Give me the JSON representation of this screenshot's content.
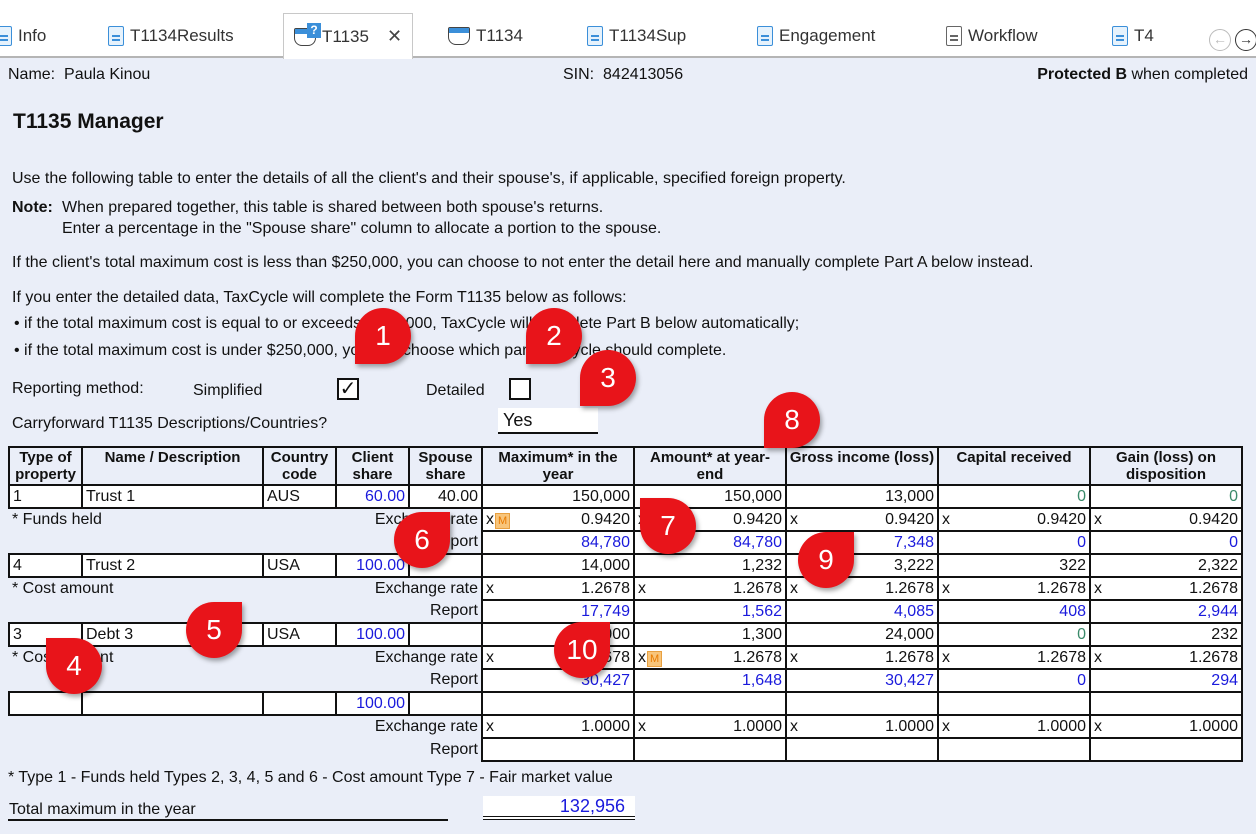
{
  "tabs": [
    {
      "label": "Info",
      "icon": "document-icon"
    },
    {
      "label": "T1134Results",
      "icon": "document-icon"
    },
    {
      "label": "T1135",
      "icon": "form-question-icon",
      "active": true
    },
    {
      "label": "T1134",
      "icon": "form-icon"
    },
    {
      "label": "T1134Sup",
      "icon": "document-icon"
    },
    {
      "label": "Engagement",
      "icon": "document-icon"
    },
    {
      "label": "Workflow",
      "icon": "document-icon"
    },
    {
      "label": "T4",
      "icon": "document-icon"
    }
  ],
  "tab_close": "✕",
  "nav": {
    "back": "←",
    "forward": "→"
  },
  "header": {
    "name_label": "Name:",
    "name": "Paula Kinou",
    "sin_label": "SIN:",
    "sin": "842413056",
    "protected_bold": "Protected B",
    "protected_rest": " when completed"
  },
  "title": "T1135 Manager",
  "intro": "Use the following table to enter the details of all the client's and their spouse's, if applicable, specified foreign property.",
  "note_label": "Note:",
  "note_line1": "When prepared together, this table is shared between both spouse's returns.",
  "note_line2": "Enter a percentage in the \"Spouse share\" column to allocate a portion to the spouse.",
  "para2": "If the client's total maximum cost is less than $250,000, you can choose to not enter the detail here and manually complete Part A below instead.",
  "para3": "If you enter the detailed data, TaxCycle will complete the Form T1135 below as follows:",
  "bullet1": "•  if the total maximum cost is equal to or exceeds $250,000, TaxCycle will complete Part B below automatically;",
  "bullet2": "•  if the total maximum cost is under $250,000, you can choose which part TaxCycle should complete.",
  "reporting": {
    "label": "Reporting method:",
    "simplified": "Simplified",
    "simplified_checked": "✓",
    "detailed": "Detailed",
    "detailed_checked": ""
  },
  "carryforward": {
    "label": "Carryforward T1135 Descriptions/Countries?",
    "value": "Yes"
  },
  "columns": [
    "Type of property",
    "Name / Description",
    "Country code",
    "Client share",
    "Spouse share",
    "Maximum* in the year",
    "Amount* at year-end",
    "Gross income (loss)",
    "Capital received",
    "Gain (loss) on disposition"
  ],
  "labels": {
    "exchange_rate": "Exchange rate",
    "report": "Report",
    "x": "x",
    "m": "M"
  },
  "properties": [
    {
      "type": "1",
      "name": "Trust 1",
      "country": "AUS",
      "client_share": "60.00",
      "spouse_share": "40.00",
      "note": "* Funds held",
      "amounts": [
        "150,000",
        "150,000",
        "13,000",
        "0",
        "0"
      ],
      "rates": [
        "0.9420",
        "0.9420",
        "0.9420",
        "0.9420",
        "0.9420"
      ],
      "reports": [
        "84,780",
        "84,780",
        "7,348",
        "0",
        "0"
      ]
    },
    {
      "type": "4",
      "name": "Trust 2",
      "country": "USA",
      "client_share": "100.00",
      "spouse_share": "",
      "note": "* Cost amount",
      "amounts": [
        "14,000",
        "1,232",
        "3,222",
        "322",
        "2,322"
      ],
      "rates": [
        "1.2678",
        "1.2678",
        "1.2678",
        "1.2678",
        "1.2678"
      ],
      "reports": [
        "17,749",
        "1,562",
        "4,085",
        "408",
        "2,944"
      ]
    },
    {
      "type": "3",
      "name": "Debt 3",
      "country": "USA",
      "client_share": "100.00",
      "spouse_share": "",
      "note": "* Cost amount",
      "amounts": [
        "24,000",
        "1,300",
        "24,000",
        "0",
        "232"
      ],
      "rates": [
        "1.2678",
        "1.2678",
        "1.2678",
        "1.2678",
        "1.2678"
      ],
      "reports": [
        "30,427",
        "1,648",
        "30,427",
        "0",
        "294"
      ]
    },
    {
      "type": "",
      "name": "",
      "country": "",
      "client_share": "100.00",
      "spouse_share": "",
      "note": "",
      "amounts": [
        "",
        "",
        "",
        "",
        ""
      ],
      "rates": [
        "1.0000",
        "1.0000",
        "1.0000",
        "1.0000",
        "1.0000"
      ],
      "reports": [
        "",
        "",
        "",
        "",
        ""
      ]
    }
  ],
  "footnote": "* Type 1 - Funds held      Types 2, 3, 4, 5 and 6 - Cost amount      Type 7 - Fair market value",
  "total": {
    "label": "Total maximum in the year",
    "value": "132,956"
  },
  "callouts": [
    "1",
    "2",
    "3",
    "4",
    "5",
    "6",
    "7",
    "8",
    "9",
    "10"
  ]
}
